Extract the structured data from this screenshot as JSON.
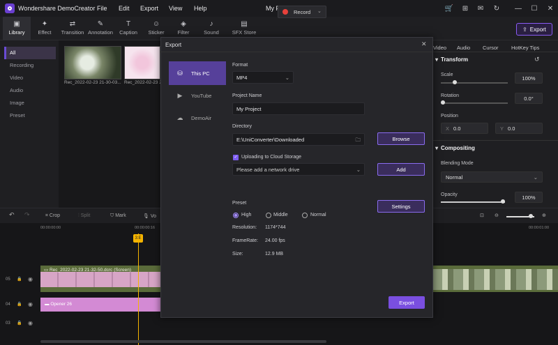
{
  "app": {
    "title": "Wondershare DemoCreator",
    "project": "My Project"
  },
  "menu": [
    "File",
    "Edit",
    "Export",
    "View",
    "Help"
  ],
  "toolbar": {
    "tabs": [
      "Library",
      "Effect",
      "Transition",
      "Annotation",
      "Caption",
      "Sticker",
      "Filter",
      "Sound",
      "SFX Store"
    ],
    "record_label": "Record",
    "export_label": "Export"
  },
  "library_nav": [
    "All",
    "Recording",
    "Video",
    "Audio",
    "Image",
    "Preset"
  ],
  "media": [
    {
      "label": "Rec_2022-02-23 21-30-03..."
    },
    {
      "label": "Rec_2022-02-23 21-32-5..."
    }
  ],
  "right_panel": {
    "tabs": [
      "Video",
      "Audio",
      "Cursor",
      "HotKey Tips"
    ],
    "transform_title": "Transform",
    "scale_label": "Scale",
    "scale_value": "100%",
    "rotation_label": "Rotation",
    "rotation_value": "0.0°",
    "position_label": "Position",
    "pos_x_label": "X",
    "pos_x": "0.0",
    "pos_y_label": "Y",
    "pos_y": "0.0",
    "compositing_title": "Compositing",
    "blending_label": "Blending Mode",
    "blending_value": "Normal",
    "opacity_label": "Opacity",
    "opacity_value": "100%"
  },
  "timeline_bar": {
    "crop": "Crop",
    "split": "Split",
    "mark": "Mark",
    "voice": "Vo"
  },
  "timeline": {
    "ruler": [
      "00:00:00:00",
      "00:00:00:16",
      "00:00:01:00"
    ],
    "playhead_label": "3:E",
    "tracks": [
      {
        "num": "05",
        "clip": "Rec_2022-02-23 21-32-50.dcrc (Screen)"
      },
      {
        "num": "04",
        "clip": "Opener 26"
      },
      {
        "num": "03",
        "clip": ""
      }
    ]
  },
  "dialog": {
    "title": "Export",
    "destinations": [
      "This PC",
      "YouTube",
      "DemoAir"
    ],
    "format_label": "Format",
    "format_value": "MP4",
    "project_name_label": "Project Name",
    "project_name_value": "My Project",
    "directory_label": "Directory",
    "directory_value": "E:\\UniConverter\\Downloaded",
    "browse_label": "Browse",
    "cloud_label": "Uploading to Cloud Storage",
    "cloud_placeholder": "Please add a network drive",
    "add_label": "Add",
    "preset_label": "Preset",
    "presets": [
      "High",
      "Middle",
      "Normal"
    ],
    "settings_label": "Settings",
    "resolution_label": "Resolution:",
    "resolution_value": "1174*744",
    "framerate_label": "FrameRate:",
    "framerate_value": "24.00 fps",
    "size_label": "Size:",
    "size_value": "12.9 MB",
    "export_label": "Export"
  },
  "colors": {
    "accent": "#7a4fe0",
    "record": "#e8413b",
    "playhead": "#f5b400",
    "opener_clip": "#d38ad4",
    "video_track": "#5a6b3a"
  }
}
